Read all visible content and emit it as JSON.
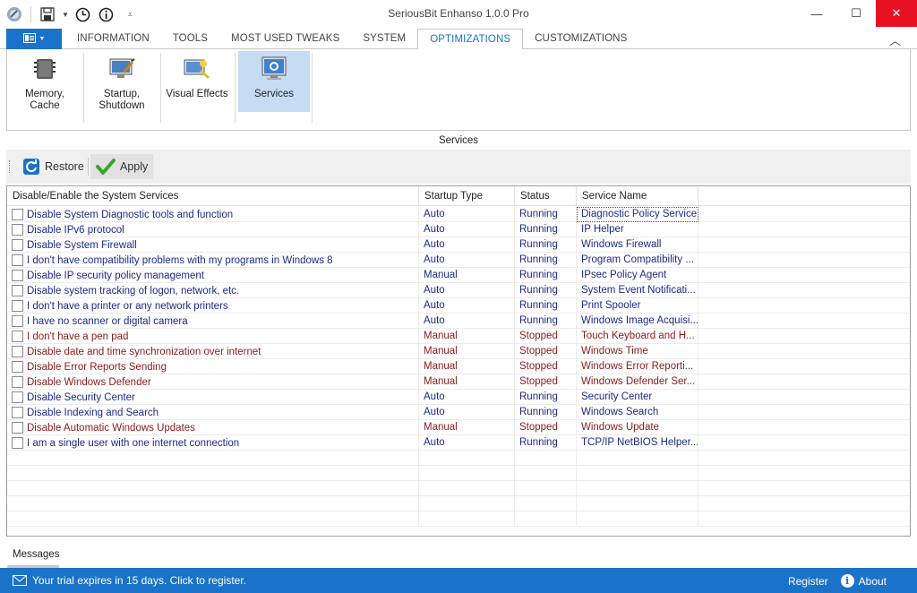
{
  "window": {
    "title": "SeriousBit Enhanso 1.0.0 Pro",
    "minimize": "—",
    "maximize": "☐",
    "close": "✕"
  },
  "tabs": [
    {
      "label": "INFORMATION"
    },
    {
      "label": "TOOLS"
    },
    {
      "label": "MOST USED TWEAKS"
    },
    {
      "label": "SYSTEM"
    },
    {
      "label": "OPTIMIZATIONS"
    },
    {
      "label": "CUSTOMIZATIONS"
    }
  ],
  "active_tab": "OPTIMIZATIONS",
  "ribbon": {
    "memory": "Memory,\nCache",
    "startup": "Startup,\nShutdown",
    "visual": "Visual Effects",
    "services": "Services"
  },
  "section_title": "Services",
  "toolbar": {
    "restore": "Restore",
    "apply": "Apply"
  },
  "grid": {
    "columns": [
      "Disable/Enable the System Services",
      "Startup Type",
      "Status",
      "Service Name"
    ],
    "rows": [
      {
        "text": "Disable System Diagnostic tools and function",
        "type": "Auto",
        "status": "Running",
        "service": "Diagnostic Policy Service",
        "checked": false
      },
      {
        "text": "Disable IPv6 protocol",
        "type": "Auto",
        "status": "Running",
        "service": "IP Helper",
        "checked": false
      },
      {
        "text": "Disable System Firewall",
        "type": "Auto",
        "status": "Running",
        "service": "Windows Firewall",
        "checked": false
      },
      {
        "text": "I don't have compatibility problems with my programs in Windows 8",
        "type": "Auto",
        "status": "Running",
        "service": "Program Compatibility ...",
        "checked": false
      },
      {
        "text": "Disable IP security policy management",
        "type": "Manual",
        "status": "Running",
        "service": "IPsec Policy Agent",
        "checked": false
      },
      {
        "text": "Disable system tracking of logon, network, etc.",
        "type": "Auto",
        "status": "Running",
        "service": "System Event Notificati...",
        "checked": false
      },
      {
        "text": "I don't have a printer or any network printers",
        "type": "Auto",
        "status": "Running",
        "service": "Print Spooler",
        "checked": false
      },
      {
        "text": "I have no scanner or digital camera",
        "type": "Auto",
        "status": "Running",
        "service": "Windows Image Acquisi...",
        "checked": false
      },
      {
        "text": "I don't have a pen pad",
        "type": "Manual",
        "status": "Stopped",
        "service": "Touch Keyboard and H...",
        "checked": false
      },
      {
        "text": "Disable date and time synchronization over internet",
        "type": "Manual",
        "status": "Stopped",
        "service": "Windows Time",
        "checked": false
      },
      {
        "text": "Disable Error Reports Sending",
        "type": "Manual",
        "status": "Stopped",
        "service": "Windows Error Reporti...",
        "checked": false
      },
      {
        "text": "Disable Windows Defender",
        "type": "Manual",
        "status": "Stopped",
        "service": "Windows Defender Ser...",
        "checked": false
      },
      {
        "text": "Disable Security Center",
        "type": "Auto",
        "status": "Running",
        "service": "Security Center",
        "checked": false
      },
      {
        "text": "Disable Indexing and Search",
        "type": "Auto",
        "status": "Running",
        "service": "Windows Search",
        "checked": false
      },
      {
        "text": "Disable Automatic Windows Updates",
        "type": "Manual",
        "status": "Stopped",
        "service": "Windows Update",
        "checked": false
      },
      {
        "text": "I am a single user with one internet connection",
        "type": "Auto",
        "status": "Running",
        "service": "TCP/IP NetBIOS Helper...",
        "checked": false
      }
    ]
  },
  "colors": {
    "running": "#1c2a8c",
    "stopped": "#8b1a1a",
    "accent": "#1a73c8"
  },
  "messages_tab": "Messages",
  "statusbar": {
    "trial": "Your trial expires in 15 days. Click to register.",
    "register": "Register",
    "about": "About"
  }
}
